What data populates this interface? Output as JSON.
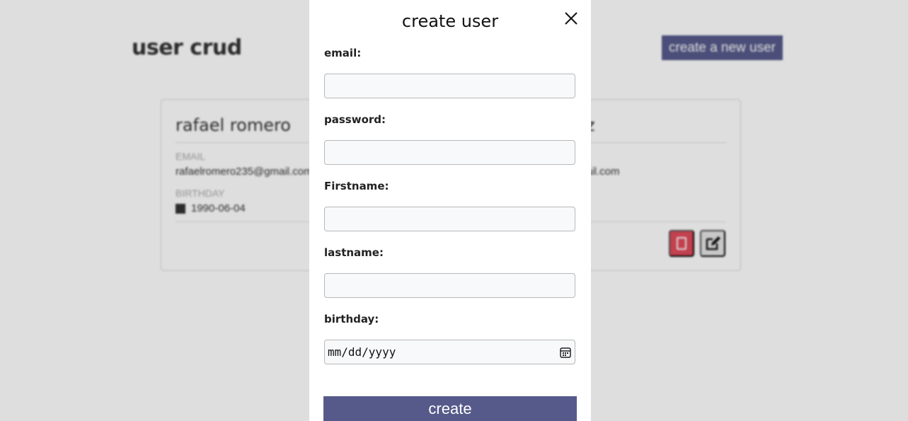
{
  "background": {
    "title": "user crud",
    "create_button": "create a new user",
    "cards": [
      {
        "name": "rafael romero",
        "email_label": "EMAIL",
        "email": "rafaelromero235@gmail.com",
        "birthday_label": "BIRTHDAY",
        "birthday": "1990-06-04"
      },
      {
        "name": "z",
        "email": "ail.com"
      }
    ]
  },
  "modal": {
    "title": "create user",
    "close_icon": "close-icon",
    "fields": {
      "email_label": "email:",
      "email_value": "",
      "password_label": "password:",
      "password_value": "",
      "firstname_label": "Firstname:",
      "firstname_value": "",
      "lastname_label": "lastname:",
      "lastname_value": "",
      "birthday_label": "birthday:",
      "birthday_placeholder": "mm/dd/yyyy"
    },
    "submit_label": "create"
  },
  "colors": {
    "accent": "#565a8a",
    "delete": "#e04b5a"
  }
}
